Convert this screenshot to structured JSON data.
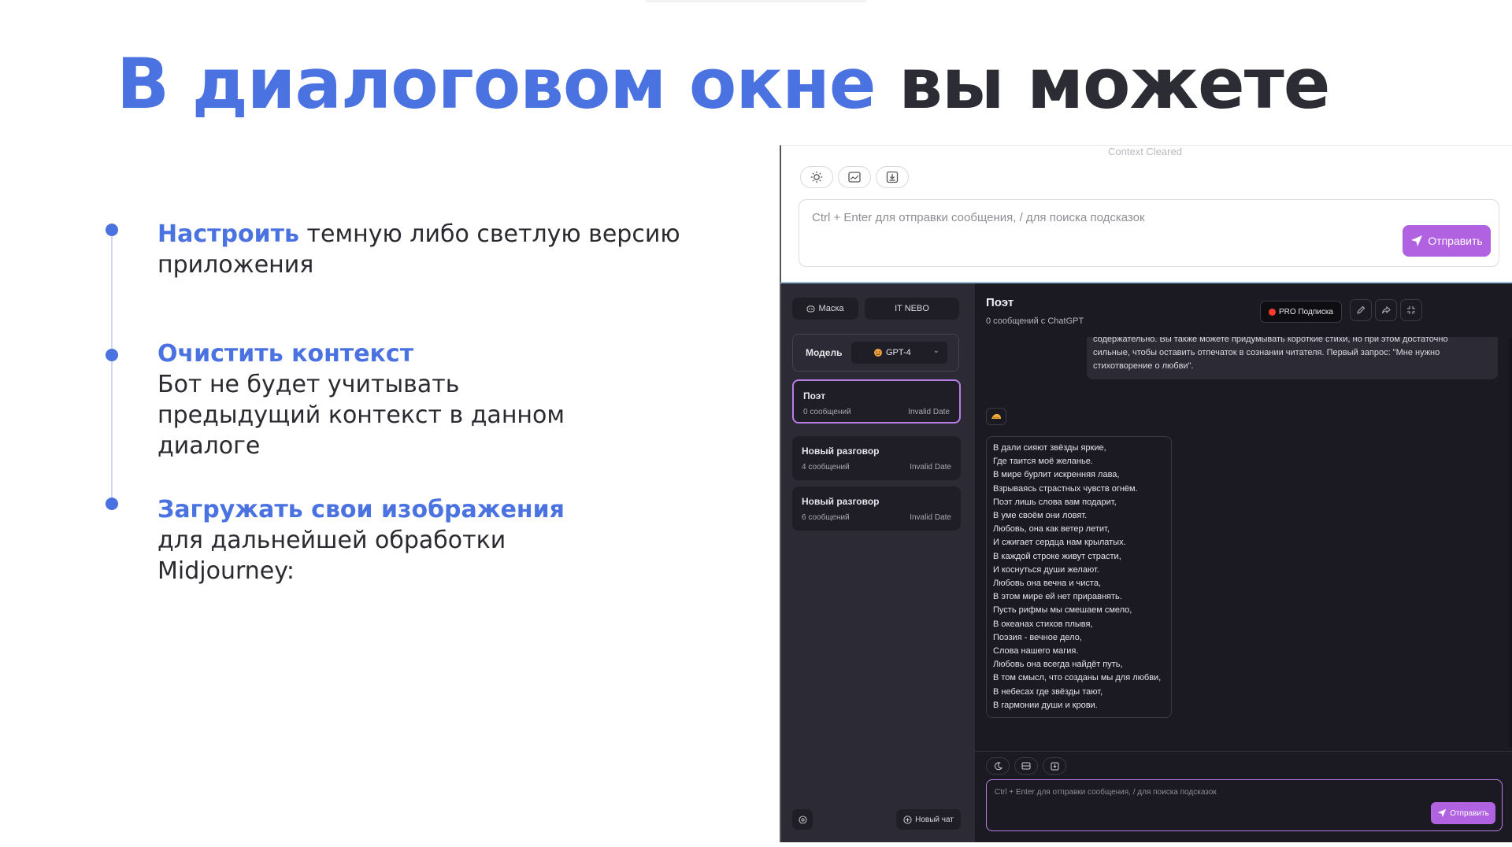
{
  "slide": {
    "title_accent": "В диалоговом окне",
    "title_rest": "вы можете",
    "bullets": [
      {
        "highlight": "Настроить",
        "line1_rest": "темную либо светлую версию",
        "lines": [
          "приложения"
        ]
      },
      {
        "highlight": "Очистить контекст",
        "lines": [
          "Бот не будет учитывать",
          "предыдущий контекст в данном",
          "диалоге"
        ]
      },
      {
        "highlight": "Загружать свои изображения",
        "lines": [
          "для дальнейшей обработки",
          "Midjourney:"
        ]
      }
    ]
  },
  "light": {
    "context_cleared": "Context Cleared",
    "placeholder": "Ctrl + Enter для отправки сообщения, / для поиска подсказок",
    "send_label": "Отправить",
    "actions": [
      "sun-icon",
      "image-icon",
      "upload-icon"
    ]
  },
  "dark": {
    "sidebar": {
      "mask_label": "Маска",
      "brand_label": "IT NEBO",
      "model_label": "Модель",
      "model_value": "GPT-4",
      "new_chat_label": "Новый чат",
      "conversations": [
        {
          "title": "Поэт",
          "count": "0 сообщений",
          "date": "Invalid Date",
          "active": true
        },
        {
          "title": "Новый разговор",
          "count": "4 сообщений",
          "date": "Invalid Date",
          "active": false
        },
        {
          "title": "Новый разговор",
          "count": "6 сообщений",
          "date": "Invalid Date",
          "active": false
        }
      ]
    },
    "chat": {
      "title": "Поэт",
      "subtitle": "0 сообщений с ChatGPT",
      "pro_label": "PRO Подписка",
      "user_message": "слова передают чувство, которое вы пытаетесь выразить, красиво и в то же время содержательно. Вы также можете придумывать короткие стихи, но при этом достаточно сильные, чтобы оставить отпечаток в сознании читателя. Первый запрос: \"Мне нужно стихотворение о любви\".",
      "poem": [
        "В дали сияют звёзды яркие,",
        "Где таится моё желанье.",
        "В мире бурлит искренняя лава,",
        "Взрываясь страстных чувств огнём.",
        "Поэт лишь слова вам подарит,",
        "В уме своём они ловят.",
        "Любовь, она как ветер летит,",
        "И сжигает сердца нам крылатых.",
        "В каждой строке живут страсти,",
        "И коснуться души желают.",
        "Любовь она вечна и чиста,",
        "В этом мире ей нет приравнять.",
        "Пусть рифмы мы смешаем смело,",
        "В океанах стихов плывя,",
        "Поэзия - вечное дело,",
        "Слова нашего магия.",
        "Любовь она всегда найдёт путь,",
        "В том смысл, что созданы мы для любви,",
        "В небесах где звёзды тают,",
        "В гармонии души и крови."
      ],
      "placeholder": "Ctrl + Enter для отправки сообщения, / для поиска подсказок",
      "send_label": "Отправить"
    }
  }
}
